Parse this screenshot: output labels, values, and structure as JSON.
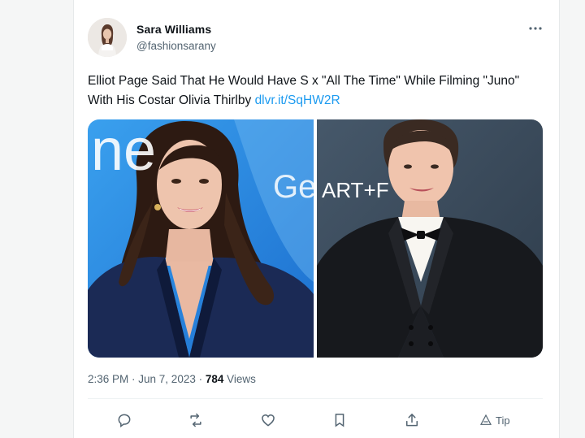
{
  "author": {
    "name": "Sara Williams",
    "handle": "@fashionsarany"
  },
  "more_icon": "more-horizontal-icon",
  "tweet": {
    "text": "Elliot Page Said That He Would Have S  x \"All The Time\" While Filming \"Juno\" With His Costar Olivia Thirlby ",
    "link": "dlvr.it/SqHW2R"
  },
  "media": {
    "left_sign": "ne",
    "left_sign2": "Ge",
    "right_sign": "ART+F"
  },
  "meta": {
    "time": "2:36 PM",
    "date": "Jun 7, 2023",
    "views_count": "784",
    "views_label": "Views"
  },
  "actions": {
    "tip_label": "Tip",
    "icons": [
      "reply-icon",
      "retweet-icon",
      "like-icon",
      "bookmark-icon",
      "share-icon",
      "tip-icon"
    ]
  },
  "colors": {
    "link": "#1d9bf0",
    "secondary_text": "#536471",
    "primary_text": "#0f1419",
    "left_backdrop": "#2b8fe0",
    "right_backdrop": "#3a4a59"
  }
}
